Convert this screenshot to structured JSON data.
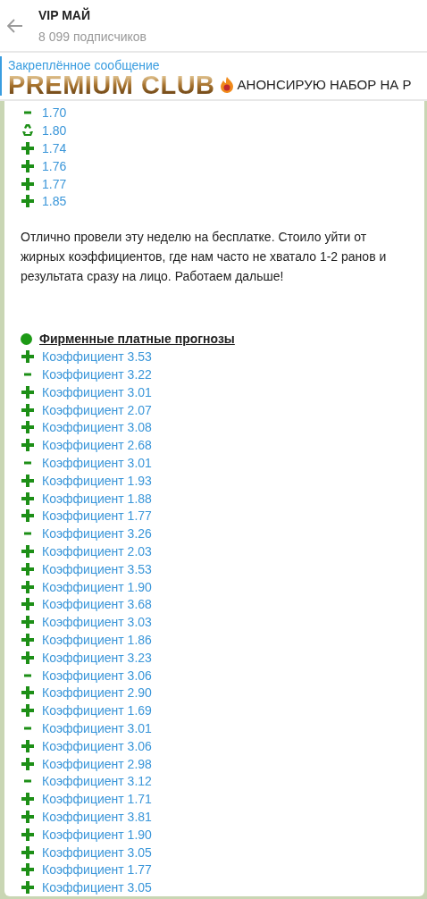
{
  "header": {
    "title": "VIP МАЙ",
    "subtitle": "8 099 подписчиков"
  },
  "pinned": {
    "label": "Закреплённое сообщение",
    "brand": "PREMIUM CLUB",
    "text": "АНОНСИРУЮ НАБОР НА Р"
  },
  "message": {
    "results": [
      {
        "kind": "minus",
        "text": "1.70"
      },
      {
        "kind": "refund",
        "text": "1.80"
      },
      {
        "kind": "plus",
        "text": "1.74"
      },
      {
        "kind": "plus",
        "text": "1.76"
      },
      {
        "kind": "plus",
        "text": "1.77"
      },
      {
        "kind": "plus",
        "text": "1.85"
      }
    ],
    "paragraph": "Отлично провели эту неделю на бесплатке. Стоило уйти от жирных коэффициентов, где нам часто не хватало 1-2 ранов и результата сразу на лицо. Работаем дальше!",
    "section_title": "Фирменные платные прогнозы",
    "paid": [
      {
        "kind": "plus",
        "text": "Коэффициент 3.53"
      },
      {
        "kind": "minus",
        "text": "Коэффициент 3.22"
      },
      {
        "kind": "plus",
        "text": "Коэффициент 3.01"
      },
      {
        "kind": "plus",
        "text": "Коэффициент 2.07"
      },
      {
        "kind": "plus",
        "text": "Коэффициент 3.08"
      },
      {
        "kind": "plus",
        "text": "Коэффициент 2.68"
      },
      {
        "kind": "minus",
        "text": "Коэффициент 3.01"
      },
      {
        "kind": "plus",
        "text": "Коэффициент 1.93"
      },
      {
        "kind": "plus",
        "text": "Коэффициент 1.88"
      },
      {
        "kind": "plus",
        "text": "Коэффициент 1.77"
      },
      {
        "kind": "minus",
        "text": "Коэффициент 3.26"
      },
      {
        "kind": "plus",
        "text": "Коэффициент 2.03"
      },
      {
        "kind": "plus",
        "text": "Коэффициент 3.53"
      },
      {
        "kind": "plus",
        "text": "Коэффициент 1.90"
      },
      {
        "kind": "plus",
        "text": "Коэффициент 3.68"
      },
      {
        "kind": "plus",
        "text": "Коэффициент 3.03"
      },
      {
        "kind": "plus",
        "text": "Коэффициент 1.86"
      },
      {
        "kind": "plus",
        "text": "Коэффициент 3.23"
      },
      {
        "kind": "minus",
        "text": "Коэффициент 3.06"
      },
      {
        "kind": "plus",
        "text": "Коэффициент 2.90"
      },
      {
        "kind": "plus",
        "text": "Коэффициент 1.69"
      },
      {
        "kind": "minus",
        "text": "Коэффициент 3.01"
      },
      {
        "kind": "plus",
        "text": "Коэффициент 3.06"
      },
      {
        "kind": "plus",
        "text": "Коэффициент 2.98"
      },
      {
        "kind": "minus",
        "text": "Коэффициент 3.12"
      },
      {
        "kind": "plus",
        "text": "Коэффициент 1.71"
      },
      {
        "kind": "plus",
        "text": "Коэффициент 3.81"
      },
      {
        "kind": "plus",
        "text": "Коэффициент 1.90"
      },
      {
        "kind": "plus",
        "text": "Коэффициент 3.05"
      },
      {
        "kind": "plus",
        "text": "Коэффициент 1.77"
      },
      {
        "kind": "plus",
        "text": "Коэффициент 3.05"
      }
    ]
  }
}
